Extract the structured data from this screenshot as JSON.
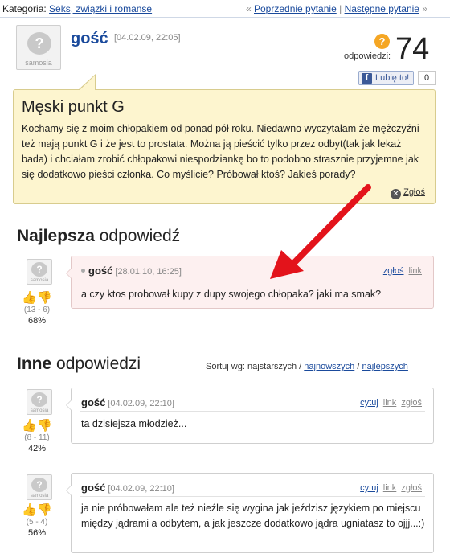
{
  "breadcrumb": {
    "category_label": "Kategoria:",
    "category_link": "Seks, związki i romanse"
  },
  "nav": {
    "prev": "Poprzednie pytanie",
    "separator": "|",
    "next": "Następne pytanie",
    "open": "«",
    "close": "»"
  },
  "question": {
    "author": "gość",
    "date": "[04.02.09, 22:05]",
    "answers_label": "odpowiedzi:",
    "answers_count": "74",
    "like_button": "Lubię to!",
    "like_count": "0",
    "title": "Męski punkt G",
    "body": "Kochamy się z moim chłopakiem od ponad pół roku. Niedawno wyczytałam że mężczyźni też mają punkt G i że jest to prostata. Można ją pieścić tylko przez odbyt(tak jak lekaż bada) i chciałam zrobić chłopakowi niespodziankę bo to podobno strasznie przyjemne jak się dodatkowo pieści członka. Co myślicie? Próbował ktoś? Jakieś porady?",
    "report": "Zgłoś"
  },
  "best": {
    "title_bold": "Najlepsza",
    "title_rest": "odpowiedź",
    "answer": {
      "author": "gość",
      "date": "[28.01.10, 16:25]",
      "report": "zgłoś",
      "link": "link",
      "text": "a czy ktos probował kupy z dupy swojego chłopaka? jaki ma smak?",
      "votes": "(13 - 6)",
      "percent": "68%"
    }
  },
  "others": {
    "title_bold": "Inne",
    "title_rest": "odpowiedzi",
    "sort": {
      "label": "Sortuj wg: najstarszych /",
      "newest": "najnowszych",
      "slash": "/",
      "best": "najlepszych"
    },
    "answers": [
      {
        "author": "gość",
        "date": "[04.02.09, 22:10]",
        "quote": "cytuj",
        "link": "link",
        "report": "zgłoś",
        "text": "ta dzisiejsza młodzież...",
        "votes": "(8 - 11)",
        "percent": "42%"
      },
      {
        "author": "gość",
        "date": "[04.02.09, 22:10]",
        "quote": "cytuj",
        "link": "link",
        "report": "zgłoś",
        "text": "ja nie próbowałam ale też nieźle się wygina jak jeździsz językiem po miejscu między jądrami a odbytem, a jak jeszcze dodatkowo jądra ugniatasz to ojjj...:)",
        "votes": "(5 - 4)",
        "percent": "56%"
      }
    ]
  },
  "avatar_text": "samosia",
  "colors": {
    "link": "#1a4a9c",
    "question_bg": "#fdf5cf",
    "best_bg": "#fdf0f0",
    "arrow": "#e3131b",
    "thumb_up": "#e04f9c",
    "thumb_down": "#e0a21c"
  },
  "icons": {
    "answers": "question-badge-icon",
    "facebook": "facebook-icon",
    "report": "close-circle-icon",
    "up": "thumbs-up-icon",
    "down": "thumbs-down-icon"
  }
}
